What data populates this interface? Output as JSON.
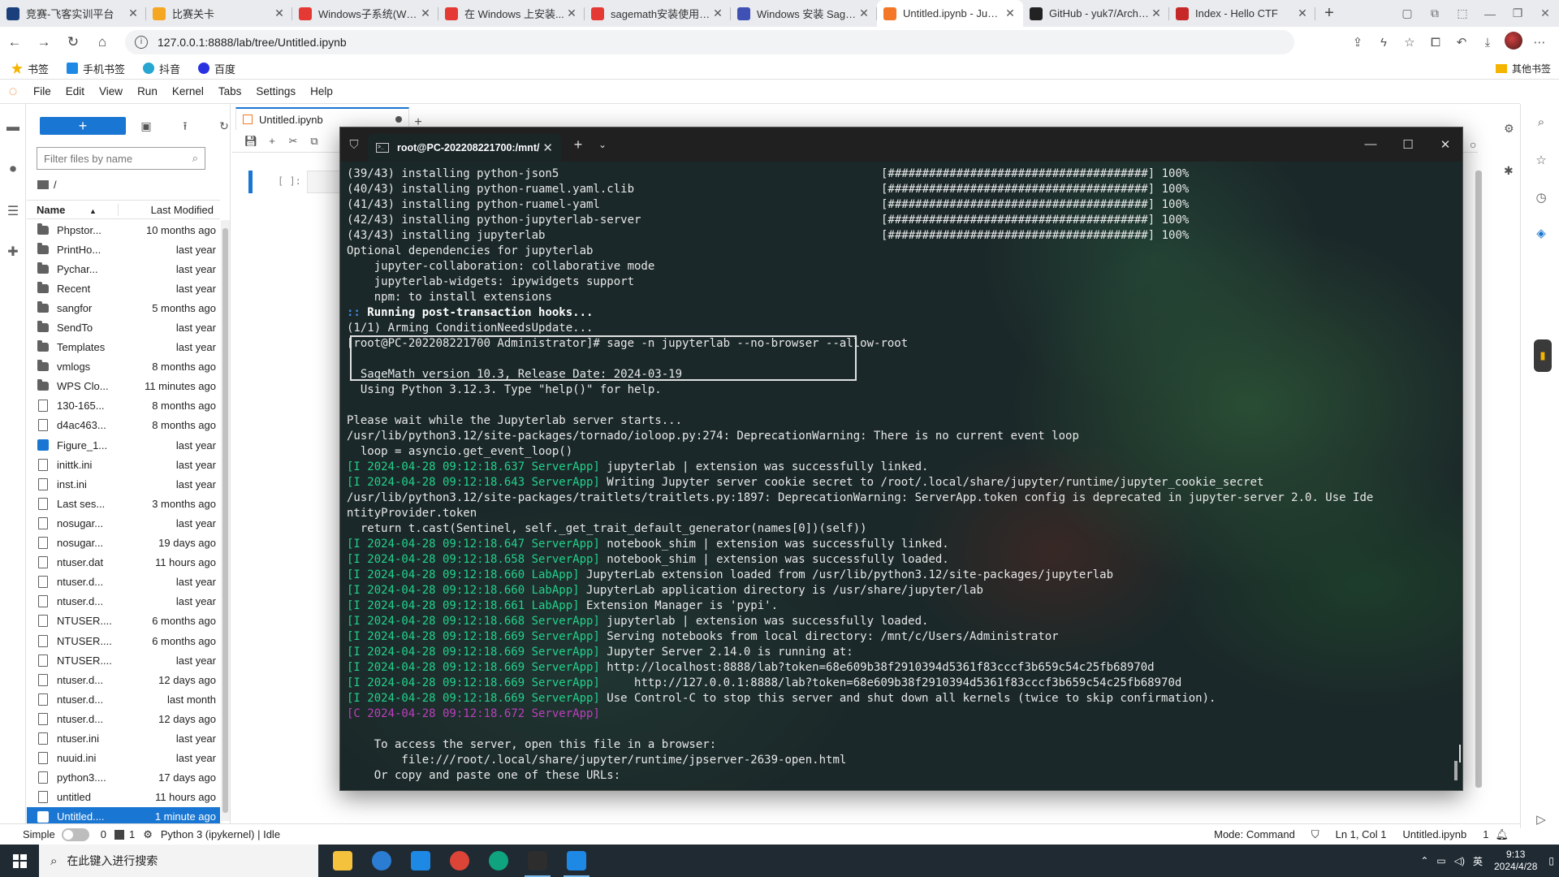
{
  "browser": {
    "tabs": [
      {
        "title": "竞赛-飞客实训平台",
        "color": "#1a3f7a"
      },
      {
        "title": "比赛关卡",
        "color": "#f5a623"
      },
      {
        "title": "Windows子系统(WSL)...",
        "color": "#e53935"
      },
      {
        "title": "在 Windows 上安装...",
        "color": "#e53935"
      },
      {
        "title": "sagemath安装使用_...",
        "color": "#e53935"
      },
      {
        "title": "Windows 安装 SageM...",
        "color": "#3f51b5"
      },
      {
        "title": "Untitled.ipynb - Jupy...",
        "color": "#f37726"
      },
      {
        "title": "GitHub - yuk7/ArchW...",
        "color": "#222222"
      },
      {
        "title": "Index - Hello CTF",
        "color": "#c62828"
      }
    ],
    "url": "127.0.0.1:8888/lab/tree/Untitled.ipynb",
    "bookmarks": [
      "书签",
      "手机书签",
      "抖音",
      "百度"
    ],
    "other_bookmarks": "其他书签"
  },
  "jupyter": {
    "menu": [
      "File",
      "Edit",
      "View",
      "Run",
      "Kernel",
      "Tabs",
      "Settings",
      "Help"
    ],
    "new_label": "+",
    "filter_placeholder": "Filter files by name",
    "breadcrumb": "/",
    "col_name": "Name",
    "col_modified": "Last Modified",
    "files": [
      {
        "name": "Phpstor...",
        "modified": "10 months ago",
        "kind": "folder"
      },
      {
        "name": "PrintHo...",
        "modified": "last year",
        "kind": "folder"
      },
      {
        "name": "Pychar...",
        "modified": "last year",
        "kind": "folder"
      },
      {
        "name": "Recent",
        "modified": "last year",
        "kind": "folder"
      },
      {
        "name": "sangfor",
        "modified": "5 months ago",
        "kind": "folder"
      },
      {
        "name": "SendTo",
        "modified": "last year",
        "kind": "folder"
      },
      {
        "name": "Templates",
        "modified": "last year",
        "kind": "folder"
      },
      {
        "name": "vmlogs",
        "modified": "8 months ago",
        "kind": "folder"
      },
      {
        "name": "WPS Clo...",
        "modified": "11 minutes ago",
        "kind": "folder"
      },
      {
        "name": "130-165...",
        "modified": "8 months ago",
        "kind": "file"
      },
      {
        "name": "d4ac463...",
        "modified": "8 months ago",
        "kind": "file"
      },
      {
        "name": "Figure_1...",
        "modified": "last year",
        "kind": "nb"
      },
      {
        "name": "inittk.ini",
        "modified": "last year",
        "kind": "file"
      },
      {
        "name": "inst.ini",
        "modified": "last year",
        "kind": "file"
      },
      {
        "name": "Last ses...",
        "modified": "3 months ago",
        "kind": "file"
      },
      {
        "name": "nosugar...",
        "modified": "last year",
        "kind": "file"
      },
      {
        "name": "nosugar...",
        "modified": "19 days ago",
        "kind": "file"
      },
      {
        "name": "ntuser.dat",
        "modified": "11 hours ago",
        "kind": "file"
      },
      {
        "name": "ntuser.d...",
        "modified": "last year",
        "kind": "file"
      },
      {
        "name": "ntuser.d...",
        "modified": "last year",
        "kind": "file"
      },
      {
        "name": "NTUSER....",
        "modified": "6 months ago",
        "kind": "file"
      },
      {
        "name": "NTUSER....",
        "modified": "6 months ago",
        "kind": "file"
      },
      {
        "name": "NTUSER....",
        "modified": "last year",
        "kind": "file"
      },
      {
        "name": "ntuser.d...",
        "modified": "12 days ago",
        "kind": "file"
      },
      {
        "name": "ntuser.d...",
        "modified": "last month",
        "kind": "file"
      },
      {
        "name": "ntuser.d...",
        "modified": "12 days ago",
        "kind": "file"
      },
      {
        "name": "ntuser.ini",
        "modified": "last year",
        "kind": "file"
      },
      {
        "name": "nuuid.ini",
        "modified": "last year",
        "kind": "file"
      },
      {
        "name": "python3....",
        "modified": "17 days ago",
        "kind": "file"
      },
      {
        "name": "untitled",
        "modified": "11 hours ago",
        "kind": "file"
      },
      {
        "name": "Untitled....",
        "modified": "1 minute ago",
        "kind": "nb",
        "selected": true
      }
    ],
    "doc_tab": "Untitled.ipynb",
    "cell_prompt": "[ ]:",
    "status": {
      "mode_toggle": "Simple",
      "count0": "0",
      "count1": "1",
      "kernel": "Python 3 (ipykernel) | Idle",
      "mode": "Mode: Command",
      "position": "Ln 1, Col 1",
      "file": "Untitled.ipynb",
      "notifications": "1"
    }
  },
  "terminal": {
    "tab_title": "root@PC-202208221700:/mnt/",
    "progress": [
      {
        "text": "(39/43) installing python-json5",
        "bar": "[######################################]",
        "pct": "100%"
      },
      {
        "text": "(40/43) installing python-ruamel.yaml.clib",
        "bar": "[######################################]",
        "pct": "100%"
      },
      {
        "text": "(41/43) installing python-ruamel-yaml",
        "bar": "[######################################]",
        "pct": "100%"
      },
      {
        "text": "(42/43) installing python-jupyterlab-server",
        "bar": "[######################################]",
        "pct": "100%"
      },
      {
        "text": "(43/43) installing jupyterlab",
        "bar": "[######################################]",
        "pct": "100%"
      }
    ],
    "optional": [
      "Optional dependencies for jupyterlab",
      "    jupyter-collaboration: collaborative mode",
      "    jupyterlab-widgets: ipywidgets support",
      "    npm: to install extensions"
    ],
    "hooks_prefix": ":: ",
    "hooks": "Running post-transaction hooks...",
    "arming": "(1/1) Arming ConditionNeedsUpdate...",
    "command": "[root@PC-202208221700 Administrator]# sage -n jupyterlab --no-browser --allow-root",
    "sage_banner": [
      "SageMath version 10.3, Release Date: 2024-03-19",
      "Using Python 3.12.3. Type \"help()\" for help."
    ],
    "wait": "Please wait while the Jupyterlab server starts...",
    "warn1": "/usr/lib/python3.12/site-packages/tornado/ioloop.py:274: DeprecationWarning: There is no current event loop",
    "warn1b": "  loop = asyncio.get_event_loop()",
    "log1": [
      {
        "tag": "[I 2024-04-28 09:12:18.637 ServerApp]",
        "msg": " jupyterlab | extension was successfully linked."
      },
      {
        "tag": "[I 2024-04-28 09:12:18.643 ServerApp]",
        "msg": " Writing Jupyter server cookie secret to /root/.local/share/jupyter/runtime/jupyter_cookie_secret"
      }
    ],
    "warn2": "/usr/lib/python3.12/site-packages/traitlets/traitlets.py:1897: DeprecationWarning: ServerApp.token config is deprecated in jupyter-server 2.0. Use Ide",
    "warn2b": "ntityProvider.token",
    "warn2c": "  return t.cast(Sentinel, self._get_trait_default_generator(names[0])(self))",
    "log2": [
      {
        "tag": "[I 2024-04-28 09:12:18.647 ServerApp]",
        "msg": " notebook_shim | extension was successfully linked."
      },
      {
        "tag": "[I 2024-04-28 09:12:18.658 ServerApp]",
        "msg": " notebook_shim | extension was successfully loaded."
      },
      {
        "tag": "[I 2024-04-28 09:12:18.660 LabApp]",
        "msg": " JupyterLab extension loaded from /usr/lib/python3.12/site-packages/jupyterlab"
      },
      {
        "tag": "[I 2024-04-28 09:12:18.660 LabApp]",
        "msg": " JupyterLab application directory is /usr/share/jupyter/lab"
      },
      {
        "tag": "[I 2024-04-28 09:12:18.661 LabApp]",
        "msg": " Extension Manager is 'pypi'."
      },
      {
        "tag": "[I 2024-04-28 09:12:18.668 ServerApp]",
        "msg": " jupyterlab | extension was successfully loaded."
      },
      {
        "tag": "[I 2024-04-28 09:12:18.669 ServerApp]",
        "msg": " Serving notebooks from local directory: /mnt/c/Users/Administrator"
      },
      {
        "tag": "[I 2024-04-28 09:12:18.669 ServerApp]",
        "msg": " Jupyter Server 2.14.0 is running at:"
      },
      {
        "tag": "[I 2024-04-28 09:12:18.669 ServerApp]",
        "msg": " http://localhost:8888/lab?token=68e609b38f2910394d5361f83cccf3b659c54c25fb68970d"
      },
      {
        "tag": "[I 2024-04-28 09:12:18.669 ServerApp]",
        "msg": "     http://127.0.0.1:8888/lab?token=68e609b38f2910394d5361f83cccf3b659c54c25fb68970d"
      },
      {
        "tag": "[I 2024-04-28 09:12:18.669 ServerApp]",
        "msg": " Use Control-C to stop this server and shut down all kernels (twice to skip confirmation)."
      }
    ],
    "critical_tag": "[C 2024-04-28 09:12:18.672 ServerApp]",
    "access": [
      "    To access the server, open this file in a browser:",
      "        file:///root/.local/share/jupyter/runtime/jpserver-2639-open.html",
      "    Or copy and paste one of these URLs:"
    ]
  },
  "taskbar": {
    "search_placeholder": "在此键入进行搜索",
    "apps": [
      {
        "name": "file-explorer",
        "color": "#f5c23d"
      },
      {
        "name": "edge-legacy",
        "color": "#2b7cd3"
      },
      {
        "name": "store-app",
        "color": "#1e88e5"
      },
      {
        "name": "chrome",
        "color": "#db4437"
      },
      {
        "name": "edge",
        "color": "#10a37f"
      },
      {
        "name": "terminal",
        "color": "#2d2d2d"
      },
      {
        "name": "calendar",
        "color": "#1e88e5"
      }
    ],
    "ime": "英",
    "time": "9:13",
    "date": "2024/4/28"
  }
}
